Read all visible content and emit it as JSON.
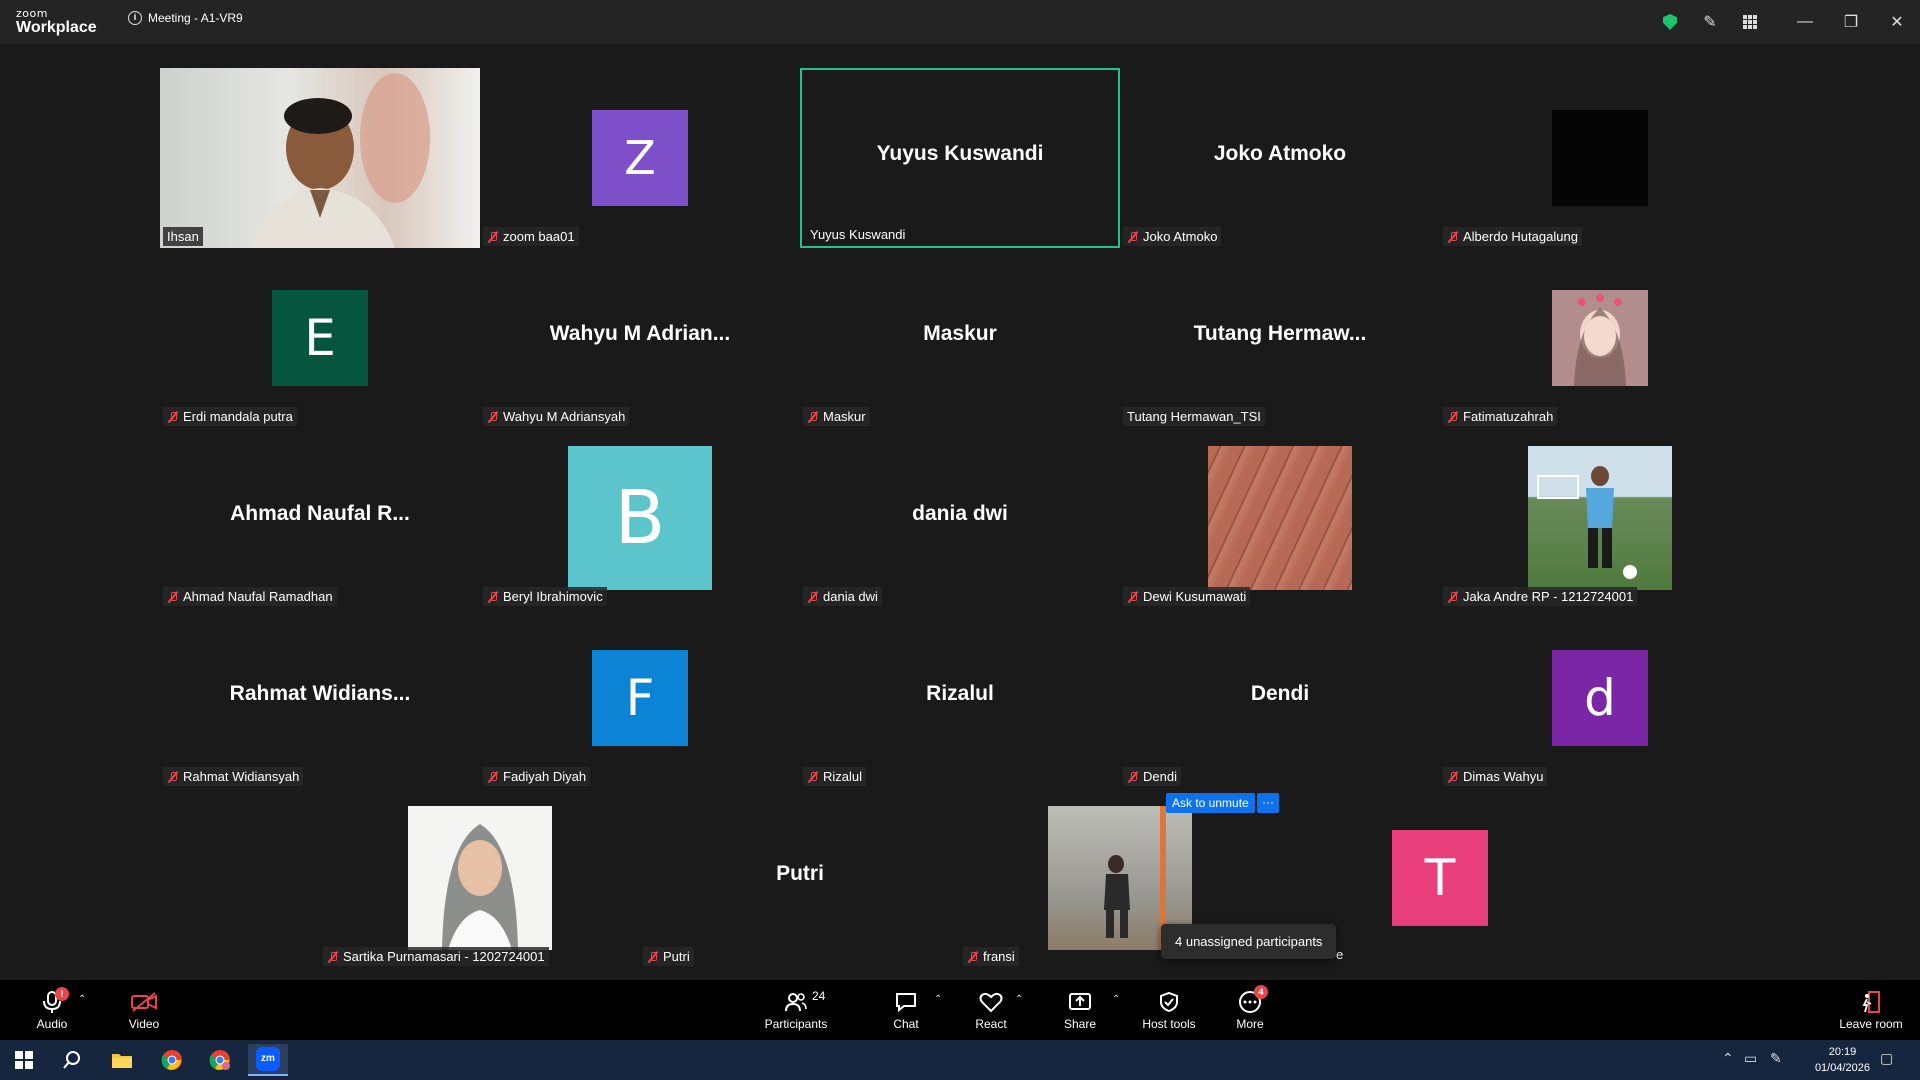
{
  "titlebar": {
    "brand_top": "zoom",
    "brand_bottom": "Workplace",
    "meeting_title": "Meeting - A1-VR9"
  },
  "tiles": [
    {
      "name": "Ihsan",
      "big": "",
      "muted": false
    },
    {
      "name": "zoom baa01",
      "big": "",
      "muted": true,
      "avatar_letter": "Z",
      "avatar_color": "#7d4fc9"
    },
    {
      "name": "Yuyus Kuswandi",
      "big": "Yuyus Kuswandi",
      "muted": false,
      "active": true
    },
    {
      "name": "Joko Atmoko",
      "big": "Joko Atmoko",
      "muted": true
    },
    {
      "name": "Alberdo Hutagalung",
      "big": "",
      "muted": true
    },
    {
      "name": "Erdi mandala putra",
      "big": "",
      "muted": true,
      "avatar_letter": "E",
      "avatar_color": "#05553f"
    },
    {
      "name": "Wahyu M Adriansyah",
      "big": "Wahyu M Adrian...",
      "muted": true
    },
    {
      "name": "Maskur",
      "big": "Maskur",
      "muted": true
    },
    {
      "name": "Tutang Hermawan_TSI",
      "big": "Tutang Hermaw...",
      "muted": false
    },
    {
      "name": "Fatimatuzahrah",
      "big": "",
      "muted": true
    },
    {
      "name": "Ahmad Naufal Ramadhan",
      "big": "Ahmad Naufal R...",
      "muted": true
    },
    {
      "name": "Beryl Ibrahimovic",
      "big": "",
      "muted": true,
      "avatar_letter": "B",
      "avatar_color": "#5cc5cc"
    },
    {
      "name": "dania dwi",
      "big": "dania dwi",
      "muted": true
    },
    {
      "name": "Dewi Kusumawati",
      "big": "",
      "muted": true
    },
    {
      "name": "Jaka Andre RP - 1212724001",
      "big": "",
      "muted": true
    },
    {
      "name": "Rahmat Widiansyah",
      "big": "Rahmat Widians...",
      "muted": true
    },
    {
      "name": "Fadiyah Diyah",
      "big": "",
      "muted": true,
      "avatar_letter": "F",
      "avatar_color": "#0b84d6"
    },
    {
      "name": "Rizalul",
      "big": "Rizalul",
      "muted": true
    },
    {
      "name": "Dendi",
      "big": "Dendi",
      "muted": true
    },
    {
      "name": "Dimas Wahyu",
      "big": "",
      "muted": true,
      "avatar_letter": "d",
      "avatar_color": "#7a26a6"
    },
    {
      "name": "Sartika Purnamasari - 1202724001",
      "big": "",
      "muted": true
    },
    {
      "name": "Putri",
      "big": "Putri",
      "muted": true
    },
    {
      "name": "fransi",
      "big": "",
      "muted": true
    },
    {
      "name": "",
      "big": "",
      "muted": false,
      "avatar_letter": "T",
      "avatar_color": "#e83e7a"
    }
  ],
  "overlays": {
    "ask_to_unmute": "Ask to unmute",
    "ask_more": "···",
    "tooltip": "4 unassigned participants",
    "partial_name_suffix": "e"
  },
  "toolbar": {
    "audio": "Audio",
    "audio_badge": "!",
    "video": "Video",
    "participants": "Participants",
    "participants_count": "24",
    "chat": "Chat",
    "react": "React",
    "share": "Share",
    "host_tools": "Host tools",
    "more": "More",
    "more_badge": "4",
    "leave": "Leave room"
  },
  "taskbar": {
    "time": "20:19",
    "date": "01/04/2026"
  },
  "colors": {
    "accent_blue": "#0e72ed",
    "active_border": "#22c28b",
    "mute_red": "#e5474b"
  }
}
